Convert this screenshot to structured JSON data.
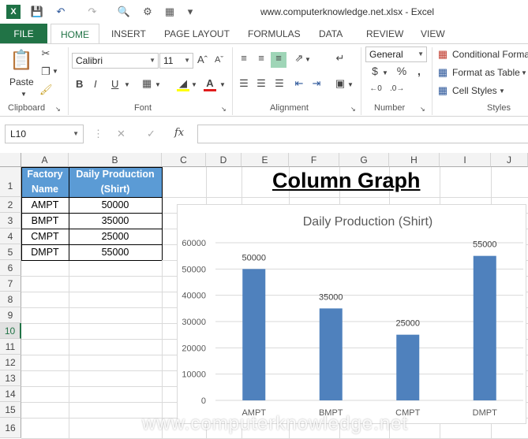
{
  "window": {
    "title": "www.computerknowledge.net.xlsx - Excel"
  },
  "tabs": {
    "file": "FILE",
    "home": "HOME",
    "insert": "INSERT",
    "page_layout": "PAGE LAYOUT",
    "formulas": "FORMULAS",
    "data": "DATA",
    "review": "REVIEW",
    "view": "VIEW"
  },
  "ribbon": {
    "clipboard": {
      "label": "Clipboard",
      "paste": "Paste"
    },
    "font": {
      "label": "Font",
      "name": "Calibri",
      "size": "11"
    },
    "alignment": {
      "label": "Alignment"
    },
    "number": {
      "label": "Number",
      "format": "General"
    },
    "styles": {
      "label": "Styles",
      "conditional": "Conditional Forma",
      "format_table": "Format as Table",
      "cell_styles": "Cell Styles"
    }
  },
  "formula_bar": {
    "name_box": "L10",
    "fx": "fx",
    "value": ""
  },
  "columns": [
    "A",
    "B",
    "C",
    "D",
    "E",
    "F",
    "G",
    "H",
    "I",
    "J"
  ],
  "rows": [
    "1",
    "2",
    "3",
    "4",
    "5",
    "6",
    "7",
    "8",
    "9",
    "10",
    "11",
    "12",
    "13",
    "14",
    "15",
    "16"
  ],
  "table": {
    "headers": [
      "Factory Name",
      "Daily Production (Shirt)"
    ],
    "rows": [
      [
        "AMPT",
        "50000"
      ],
      [
        "BMPT",
        "35000"
      ],
      [
        "CMPT",
        "25000"
      ],
      [
        "DMPT",
        "55000"
      ]
    ]
  },
  "sheet_title": "Column Graph",
  "watermark": "www.computerknowledge.net",
  "chart_data": {
    "type": "bar",
    "title": "Daily Production (Shirt)",
    "categories": [
      "AMPT",
      "BMPT",
      "CMPT",
      "DMPT"
    ],
    "values": [
      50000,
      35000,
      25000,
      55000
    ],
    "data_labels": [
      "50000",
      "35000",
      "25000",
      "55000"
    ],
    "yticks": [
      "0",
      "10000",
      "20000",
      "30000",
      "40000",
      "50000",
      "60000"
    ],
    "ylim": [
      0,
      60000
    ],
    "xlabel": "",
    "ylabel": "",
    "grid": true,
    "color": "#4f81bd"
  }
}
